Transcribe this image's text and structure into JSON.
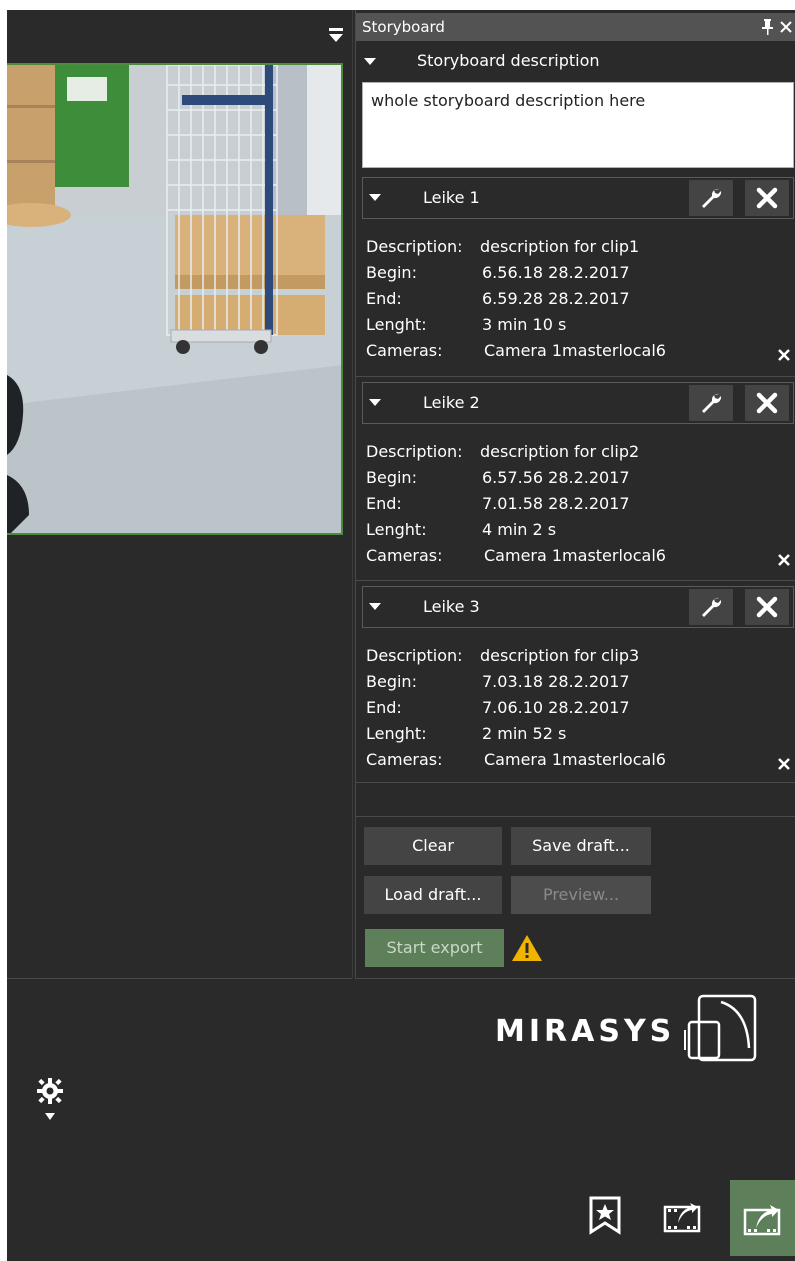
{
  "panel": {
    "title": "Storyboard",
    "section_title": "Storyboard description",
    "description_value": "whole storyboard description here"
  },
  "field_labels": {
    "description": "Description:",
    "begin": "Begin:",
    "end": "End:",
    "length": "Lenght:",
    "cameras": "Cameras:"
  },
  "clips": [
    {
      "title": "Leike 1",
      "description": "description for clip1",
      "begin": "6.56.18 28.2.2017",
      "end": "6.59.28 28.2.2017",
      "length": "3 min 10 s",
      "camera": "Camera 1masterlocal6"
    },
    {
      "title": "Leike 2",
      "description": "description for clip2",
      "begin": "6.57.56 28.2.2017",
      "end": "7.01.58 28.2.2017",
      "length": "4 min 2 s",
      "camera": "Camera 1masterlocal6"
    },
    {
      "title": "Leike 3",
      "description": "description for clip3",
      "begin": "7.03.18 28.2.2017",
      "end": "7.06.10 28.2.2017",
      "length": "2 min 52 s",
      "camera": "Camera 1masterlocal6"
    }
  ],
  "buttons": {
    "clear": "Clear",
    "save_draft": "Save draft...",
    "load_draft": "Load draft...",
    "preview": "Preview...",
    "start_export": "Start export"
  },
  "logo": {
    "text": "MIRASYS"
  },
  "colors": {
    "accent_green": "#5d7f5a",
    "warning": "#f0b400",
    "video_border": "#4e8a3b"
  }
}
